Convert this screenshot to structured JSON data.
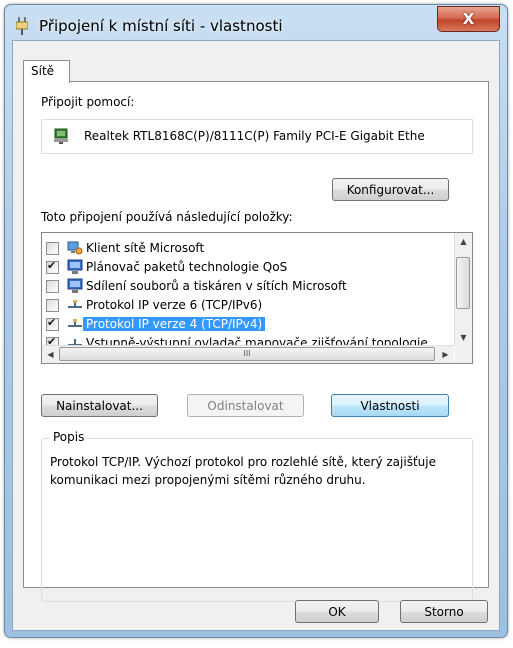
{
  "window": {
    "title": "Připojení k místní síti - vlastnosti",
    "close_label": "X"
  },
  "tabs": [
    {
      "label": "Sítě"
    }
  ],
  "connect_using": {
    "label": "Připojit pomocí:",
    "adapter": "Realtek RTL8168C(P)/8111C(P) Family PCI-E Gigabit Ethe"
  },
  "configure_button": "Konfigurovat...",
  "items_label": "Toto připojení používá následující položky:",
  "items": [
    {
      "label": "Klient sítě Microsoft",
      "checked": false,
      "icon": "network-client-icon",
      "selected": false
    },
    {
      "label": "Plánovač paketů technologie QoS",
      "checked": true,
      "icon": "qos-scheduler-icon",
      "selected": false
    },
    {
      "label": "Sdílení souborů a tiskáren v sítích Microsoft",
      "checked": false,
      "icon": "file-printer-sharing-icon",
      "selected": false
    },
    {
      "label": "Protokol IP verze 6 (TCP/IPv6)",
      "checked": false,
      "icon": "protocol-icon",
      "selected": false
    },
    {
      "label": "Protokol IP verze 4 (TCP/IPv4)",
      "checked": true,
      "icon": "protocol-icon",
      "selected": true
    },
    {
      "label": "Vstupně-výstupní ovladač mapovače zjišťování topologie",
      "checked": true,
      "icon": "protocol-icon",
      "selected": false
    }
  ],
  "scrollbar_glyph": "III",
  "buttons": {
    "install": "Nainstalovat...",
    "uninstall": "Odinstalovat",
    "properties": "Vlastnosti",
    "ok": "OK",
    "cancel": "Storno"
  },
  "description": {
    "legend": "Popis",
    "text": "Protokol TCP/IP. Výchozí protokol pro rozlehlé sítě, který zajišťuje komunikaci mezi propojenými sítěmi různého druhu."
  },
  "colors": {
    "selection": "#3399ff",
    "close_button": "#c8503a",
    "title_gradient": "#aecbe6"
  }
}
